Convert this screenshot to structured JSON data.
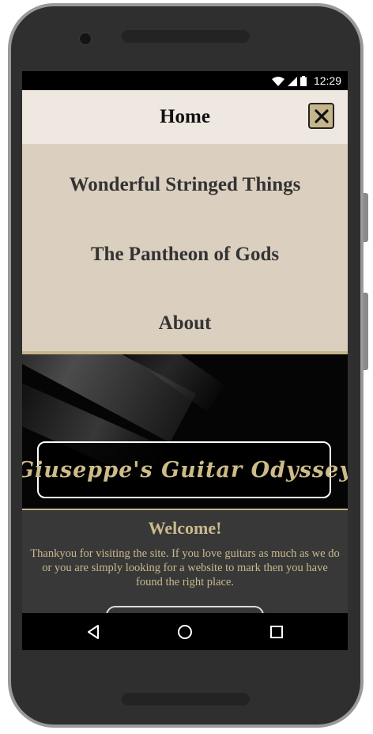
{
  "status_bar": {
    "time": "12:29",
    "icons": [
      "wifi-icon",
      "signal-icon",
      "battery-icon"
    ]
  },
  "menu": {
    "title": "Home",
    "close_icon": "close-icon",
    "items": [
      {
        "label": "Wonderful Stringed Things"
      },
      {
        "label": "The Pantheon of Gods"
      },
      {
        "label": "About"
      }
    ]
  },
  "hero": {
    "site_title": "Giuseppe's Guitar Odyssey"
  },
  "welcome": {
    "heading": "Welcome!",
    "text": "Thankyou for visiting the site. If you love guitars as much as we do or you are simply looking for a website to mark then you have found the right place."
  },
  "nav_bar": {
    "buttons": [
      "back-icon",
      "home-icon",
      "recents-icon"
    ]
  },
  "colors": {
    "accent": "#c9b98c",
    "menu_header_bg": "#efe8e0",
    "menu_bg": "#dbd0c0",
    "close_button_bg": "#c6b58a",
    "welcome_bg": "#383838"
  }
}
